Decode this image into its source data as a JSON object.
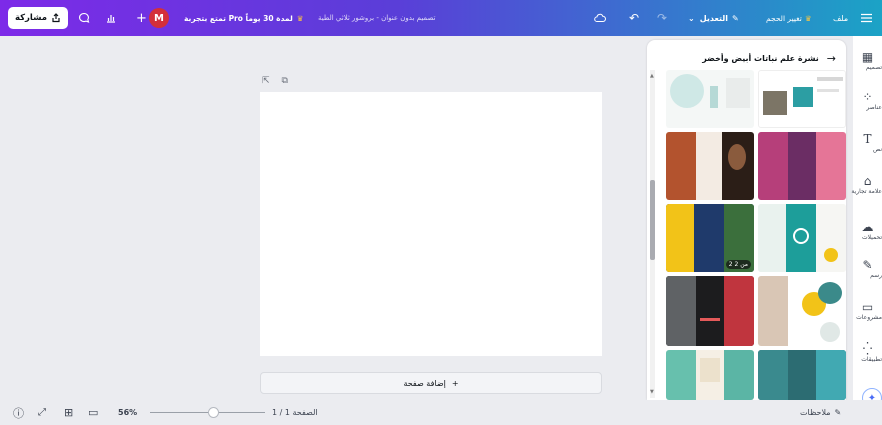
{
  "topbar": {
    "share_label": "مشاركة",
    "avatar_initial": "M",
    "pro_trial": "تمتع بتجربة Pro لمدة 30 يوماً",
    "design_title": "تصميم بدون عنوان - بروشور ثلاثي الطية",
    "edit_label": "التعديل",
    "resize_label": "تغيير الحجم",
    "file_label": "ملف"
  },
  "panel": {
    "title": "نشرة علم نباتات أبيض وأخضر",
    "page_count_badge": "2 من 2"
  },
  "sidebar": {
    "items": [
      {
        "label": "تصميم",
        "icon": "layout-icon"
      },
      {
        "label": "عناصر",
        "icon": "elements-icon"
      },
      {
        "label": "نص",
        "icon": "text-icon"
      },
      {
        "label": "علامة تجارية",
        "icon": "brand-icon"
      },
      {
        "label": "تحميلات",
        "icon": "upload-icon"
      },
      {
        "label": "رسم",
        "icon": "draw-icon"
      },
      {
        "label": "مشروعات",
        "icon": "folder-icon"
      },
      {
        "label": "تطبيقات",
        "icon": "apps-icon"
      }
    ]
  },
  "canvas": {
    "add_page_label": "إضافة صفحة"
  },
  "bottombar": {
    "notes_label": "ملاحظات",
    "page_indicator": "الصفحة 1 / 1",
    "zoom": "56%",
    "zoom_level": 0.56
  },
  "colors": {
    "top_left": "#7d2ae8",
    "top_right": "#1ba3c6",
    "avatar": "#d32f3a"
  }
}
